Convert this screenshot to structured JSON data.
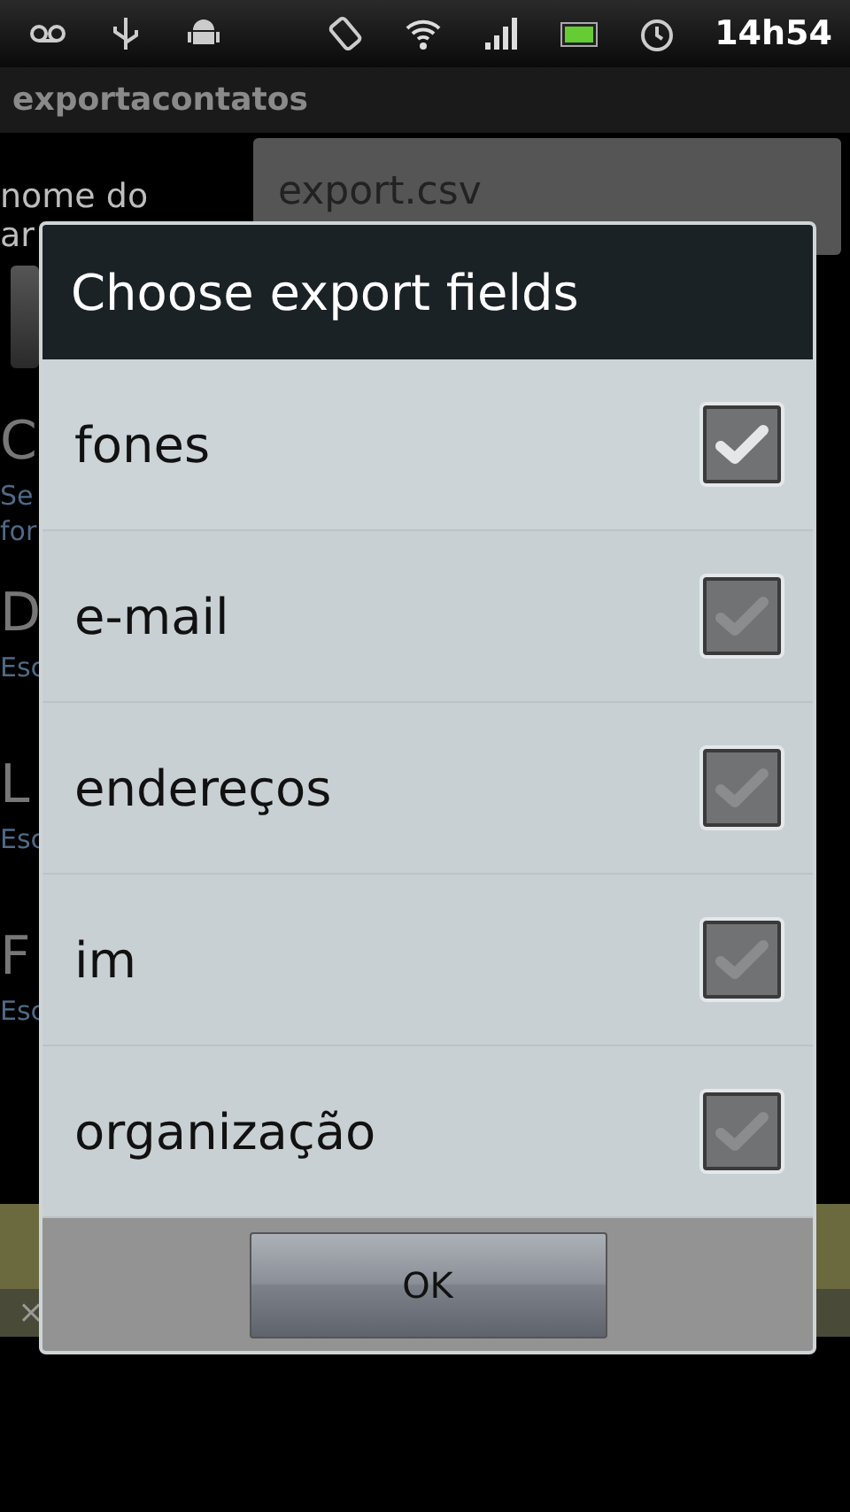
{
  "status_bar": {
    "time": "14h54"
  },
  "app": {
    "title": "exportacontatos",
    "file_label": "nome do",
    "file_label_cont": "ar",
    "file_value": "export.csv",
    "sections": [
      {
        "heading": "C",
        "lines": [
          "Se",
          "for"
        ]
      },
      {
        "heading": "D",
        "lines": [
          "Esc"
        ]
      },
      {
        "heading": "L",
        "lines": [
          "Esc"
        ]
      },
      {
        "heading": "F",
        "lines": [
          "Esc"
        ]
      }
    ],
    "banner_close": "×"
  },
  "dialog": {
    "title": "Choose export fields",
    "items": [
      {
        "label": "fones",
        "checked": true,
        "focused": true
      },
      {
        "label": "e-mail",
        "checked": true,
        "focused": false
      },
      {
        "label": "endereços",
        "checked": true,
        "focused": false
      },
      {
        "label": "im",
        "checked": true,
        "focused": false
      },
      {
        "label": "organização",
        "checked": true,
        "focused": false
      }
    ],
    "button": "OK"
  }
}
